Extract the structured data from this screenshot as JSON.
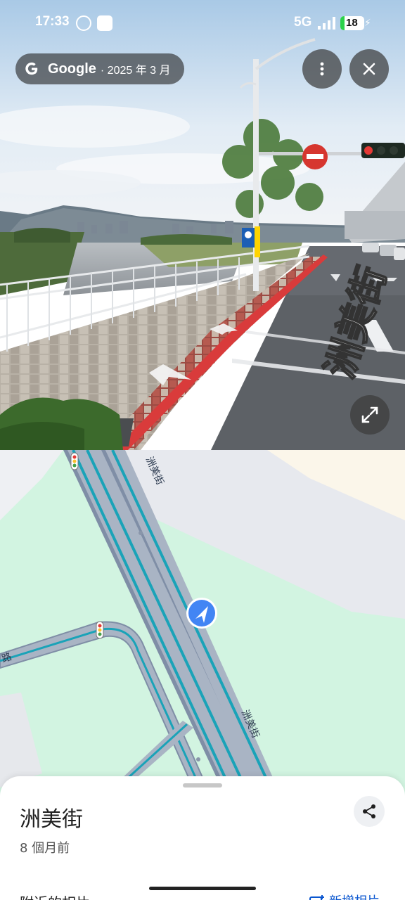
{
  "status_bar": {
    "time": "17:33",
    "network": "5G",
    "battery": "18",
    "app_icons": [
      "whatsapp-icon",
      "notification-app-icon"
    ]
  },
  "street_view": {
    "provider": "Google",
    "capture_date": "· 2025 年 3 月",
    "road_marking": "洲美街",
    "buttons": {
      "more": "more-vert-icon",
      "close": "close-icon",
      "expand": "expand-icon"
    }
  },
  "map": {
    "street_labels": [
      {
        "name": "洲美街"
      },
      {
        "name": "洲美街"
      },
      {
        "name": "路"
      }
    ],
    "colors": {
      "park": "#d2f4e1",
      "road": "#a9b4c4",
      "road_casing": "#7f8ea6",
      "transit": "#1aa3b8",
      "location": "#4285f4"
    }
  },
  "place": {
    "title": "洲美街",
    "subtitle": "8 個月前",
    "nearby_label": "附近的相片",
    "add_photo_label": "新增相片"
  },
  "colors": {
    "sheet_bg": "#ffffff",
    "accent": "#0b57d0"
  }
}
